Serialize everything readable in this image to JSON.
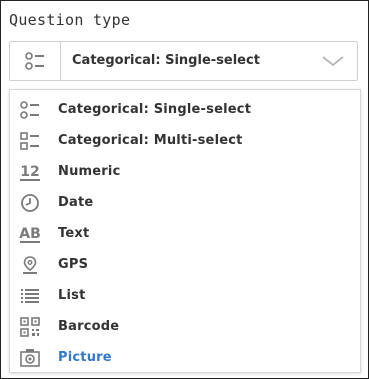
{
  "title": "Question type",
  "select": {
    "value": "Categorical: Single-select",
    "icon": "single-select-icon"
  },
  "options": [
    {
      "label": "Categorical: Single-select",
      "icon": "single-select-icon"
    },
    {
      "label": "Categorical: Multi-select",
      "icon": "multi-select-icon"
    },
    {
      "label": "Numeric",
      "icon": "numeric-icon",
      "icon_text": "12"
    },
    {
      "label": "Date",
      "icon": "clock-icon"
    },
    {
      "label": "Text",
      "icon": "text-icon",
      "icon_text": "AB"
    },
    {
      "label": "GPS",
      "icon": "location-pin-icon"
    },
    {
      "label": "List",
      "icon": "list-icon"
    },
    {
      "label": "Barcode",
      "icon": "barcode-icon"
    },
    {
      "label": "Picture",
      "icon": "camera-icon"
    }
  ],
  "colors": {
    "text": "#333333",
    "icon": "#7a7a7a",
    "accent": "#3478c6",
    "border": "#cfcfcf"
  }
}
